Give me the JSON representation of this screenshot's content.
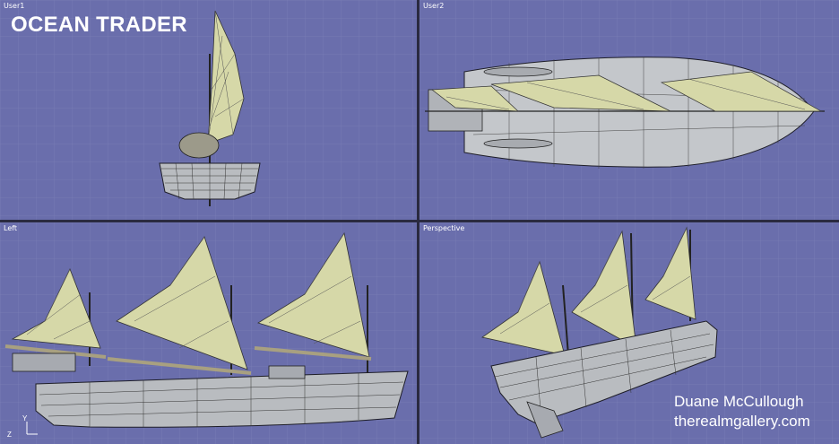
{
  "title": "OCEAN TRADER",
  "viewports": {
    "user1": {
      "label": "User1"
    },
    "user2": {
      "label": "User2"
    },
    "left": {
      "label": "Left"
    },
    "perspective": {
      "label": "Perspective"
    }
  },
  "axis": {
    "y": "Y",
    "z": "Z"
  },
  "credit": {
    "author": "Duane McCullough",
    "site": "therealmgallery.com"
  },
  "colors": {
    "viewport_bg": "#6a6eac",
    "sail": "#d6d8a8",
    "hull": "#b9bcc0",
    "wire": "#1e1e28"
  }
}
